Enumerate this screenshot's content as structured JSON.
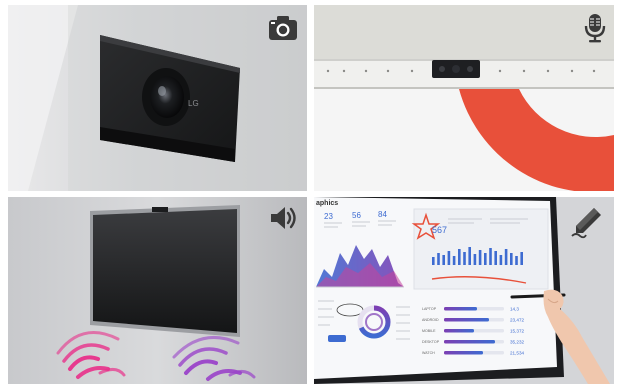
{
  "tiles": {
    "camera": {
      "icon": "camera-icon",
      "logo_text": "LG"
    },
    "microphone": {
      "icon": "microphone-icon"
    },
    "speaker": {
      "icon": "speaker-icon"
    },
    "pen": {
      "icon": "pen-icon",
      "dashboard": {
        "heading": "aphics",
        "stats": [
          "23",
          "56",
          "84"
        ],
        "big_number": "567",
        "row_values": [
          "14,3",
          "23,472",
          "15,372",
          "35,232",
          "21,534"
        ],
        "row_labels": [
          "LAPTOP",
          "ANDROID",
          "MOBILE",
          "DESKTOP",
          "WATCH"
        ]
      }
    }
  },
  "colors": {
    "accent_red": "#e8503a",
    "chart_blue": "#3d6bd1",
    "chart_purple": "#7c3fb3",
    "sound_pink": "#e8308a",
    "sound_purple": "#9a43c9"
  }
}
